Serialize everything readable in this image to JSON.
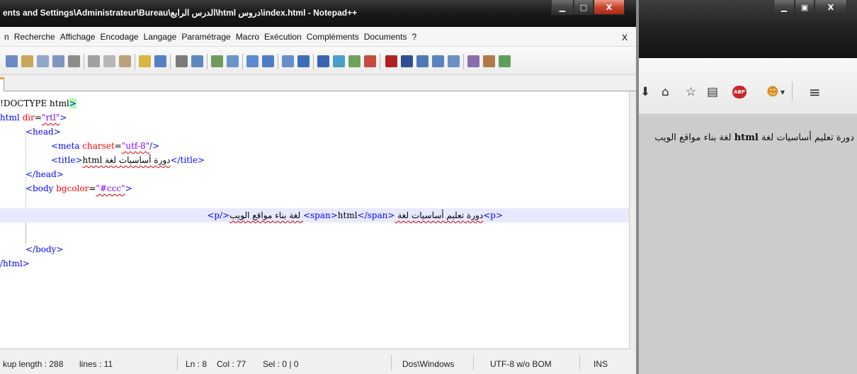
{
  "notepad": {
    "title": "ents and Settings\\Administrateur\\Bureau\\الدرس الرابع\\html دروس\\index.html - Notepad++",
    "window_buttons": {
      "minimize": "▁",
      "maximize": "□",
      "close": "X"
    },
    "menu": [
      "n",
      "Recherche",
      "Affichage",
      "Encodage",
      "Langage",
      "Paramétrage",
      "Macro",
      "Exécution",
      "Compléments",
      "Documents",
      "?"
    ],
    "menu_close": "X",
    "code": {
      "l1_a": "!DOCTYPE html",
      "l1_b": ">",
      "l2_tag": "html",
      "l2_attr": " dir",
      "l2_eq": "=",
      "l2_val": "\"rtl\"",
      "l2_close": ">",
      "l3": "<head>",
      "l4_open": "<meta",
      "l4_attr": " charset",
      "l4_eq": "=",
      "l4_val": "\"utf-8\"",
      "l4_close": "/>",
      "l5_open": "<title>",
      "l5_text": "دورة أساسيات لغة html",
      "l5_close": "</title>",
      "l6": "</head>",
      "l7_open": "<body",
      "l7_attr": " bgcolor",
      "l7_eq": "=",
      "l7_val": "\"#ccc\"",
      "l7_close": ">",
      "l8_open": "<p>",
      "l8_text1": "دورة تعليم أساسيات لغة ",
      "l8_span_open": "<span>",
      "l8_span_text": "html",
      "l8_span_close": "</span>",
      "l8_text2": " لغة بناء مواقع الويب",
      "l8_close": "</p>",
      "l10": "</body>",
      "l11": "/html>"
    },
    "status": {
      "length": "kup length : 288",
      "lines": "lines : 11",
      "ln": "Ln : 8",
      "col": "Col : 77",
      "sel": "Sel : 0 | 0",
      "eol": "Dos\\Windows",
      "encoding": "UTF-8 w/o BOM",
      "mode": "INS"
    }
  },
  "firefox": {
    "window_buttons": {
      "minimize": "▁",
      "maximize": "▣",
      "close": "X"
    },
    "toolbar": {
      "download": "⬇",
      "home": "⌂",
      "bookmark": "☆",
      "reading": "▤",
      "adblock": "ABP",
      "greasemonkey": "☻",
      "dropdown": "▾",
      "menu": "≡"
    },
    "page_text_before": "دورة تعليم أساسيات لغة ",
    "page_text_bold": "html",
    "page_text_after": " لغة بناء مواقع الويب"
  },
  "colors": {
    "tag": "#0000ff",
    "attribute": "#ff0000",
    "value": "#8000ff",
    "current_line": "#e8e8ff",
    "page_background": "#cccccc"
  }
}
